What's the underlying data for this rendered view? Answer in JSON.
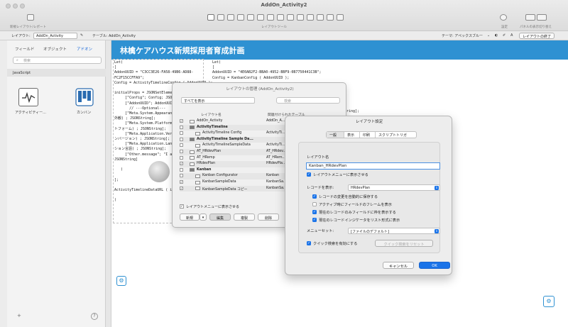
{
  "window": {
    "title": "AddOn_Activity2"
  },
  "toolbar": {
    "left_label": "新規レイアウト/レポート",
    "tools_label": "レイアウトツール",
    "inspector_label": "設定",
    "panel_label": "パネルの表示切り替え"
  },
  "layout_bar": {
    "layout_label": "レイアウト:",
    "layout_value": "AddOn_Activity",
    "table_label": "テーブル: AddOn_Activity",
    "theme_label": "テーマ: アペックスブルー",
    "exit_button": "レイアウトの終了"
  },
  "left_panel": {
    "tabs": [
      "フィールド",
      "オブジェクト",
      "アドオン"
    ],
    "search_placeholder": "検索",
    "category": "JavaScript",
    "addons": [
      {
        "label": "アクティビティー..."
      },
      {
        "label": "カンバン"
      }
    ]
  },
  "canvas": {
    "header_title": "林檎ケアハウス新規採用者育成計画",
    "code_left": "Let(\n[\nAddonUUID = \"C3CC3E26-FA58-49B6-AD88-\nFC2F15CCFFA9\";\nConfig = ActivityTimelineConfig ( AddonUUID );\n\ninitialProps = JSONSetElement( \"{}\" ;\n     [\"Config\"; Config; JSONObject] ;\n     [\"AddonUUID\"; AddonUUID; JSONString] ;\n       // ---Optional---\n     [\"Meta.System.Appearance\";\n外観) ; JSONString];\n     [\"Meta.System.Platform\" ;\nトフォーム) ; JSONString];\n     [\"Meta.Application.Version\";\nンバージョン) ; JSONString];\n     [\"Meta.Application.Language\";\nション言語) ; JSONString];\n     [\"Other.message\"; \"I am a\nJSONString]\n\n   )\n\n];\n\nActivityTimelineDataURL ( initi\n\n)",
    "code_right": "Let(\n[\nAddonUUID = \"4E0AB2F2-BBA0-4952-BBF9-0B7750441C3B\";\nConfig = KanbanConfig ( AddonUUID );",
    "code_right_tail": "tring];"
  },
  "manager": {
    "title": "レイアウトの管理 (AddOn_Activity2)",
    "filter": "すべてを表示",
    "search_placeholder": "検索",
    "col_name": "レイアウト名",
    "col_assoc": "関連付けられたテーブル",
    "rows": [
      {
        "check": "✓",
        "name": "AddOn_Activity",
        "assoc": "AddOn_A...",
        "bold": false,
        "indent": 0
      },
      {
        "check": "",
        "name": "ActivityTimeline",
        "assoc": "",
        "bold": true,
        "indent": 0
      },
      {
        "check": "",
        "name": "ActivityTimeline Config",
        "assoc": "ActivityTi...",
        "bold": false,
        "indent": 1
      },
      {
        "check": "",
        "name": "ActivityTimeline Sample Da...",
        "assoc": "",
        "bold": true,
        "indent": 0
      },
      {
        "check": "",
        "name": "ActivityTimelineSampleData",
        "assoc": "ActivityTi...",
        "bold": false,
        "indent": 1
      },
      {
        "check": "",
        "name": "AT_HRdevPlan",
        "assoc": "AT_HRdev...",
        "bold": false,
        "indent": 0
      },
      {
        "check": "",
        "name": "AT_HRemp",
        "assoc": "AT_HRem...",
        "bold": false,
        "indent": 0
      },
      {
        "check": "✓",
        "name": "HRdevPlan",
        "assoc": "HRdevPla...",
        "bold": false,
        "indent": 0
      },
      {
        "check": "",
        "name": "Kanban",
        "assoc": "",
        "bold": true,
        "indent": 0
      },
      {
        "check": "",
        "name": "Kanban Configurator",
        "assoc": "Kanban",
        "bold": false,
        "indent": 1
      },
      {
        "check": "✓",
        "name": "KanbanSampleData",
        "assoc": "KanbanSa...",
        "bold": false,
        "indent": 1
      },
      {
        "check": "✓",
        "name": "KanbanSampleData コピー",
        "assoc": "KanbanSa...",
        "bold": false,
        "indent": 1
      }
    ],
    "show_in_menu": "レイアウトメニューに表示させる",
    "new_button": "新規",
    "edit_button": "編集",
    "duplicate_button": "複製",
    "delete_button": "削除"
  },
  "setup": {
    "title": "レイアウト設定",
    "tabs": [
      "一般",
      "表示",
      "印刷",
      "スクリプトトリガ"
    ],
    "name_label": "レイアウト名",
    "name_value": "Kanban_HRdevPlan",
    "show_in_menu": "レイアウトメニューに表示させる",
    "records_label": "レコードを表示:",
    "records_value": "HRdevPlan",
    "opt_autosave": "レコードの変更を自動的に保存する",
    "opt_frames": "アクティブ時にフィールドのフレームを表示",
    "opt_active_only": "現在のレコードのみフィールドに枠を表示する",
    "opt_indicator": "現在のレコードインジケータをリスト形式に表示",
    "menu_set_label": "メニューセット:",
    "menu_set_value": "[ファイルのデフォルト]",
    "quick_find": "クイック検索を有効にする",
    "quick_find_reset": "クイック検索をリセット",
    "cancel": "キャンセル",
    "ok": "OK"
  }
}
